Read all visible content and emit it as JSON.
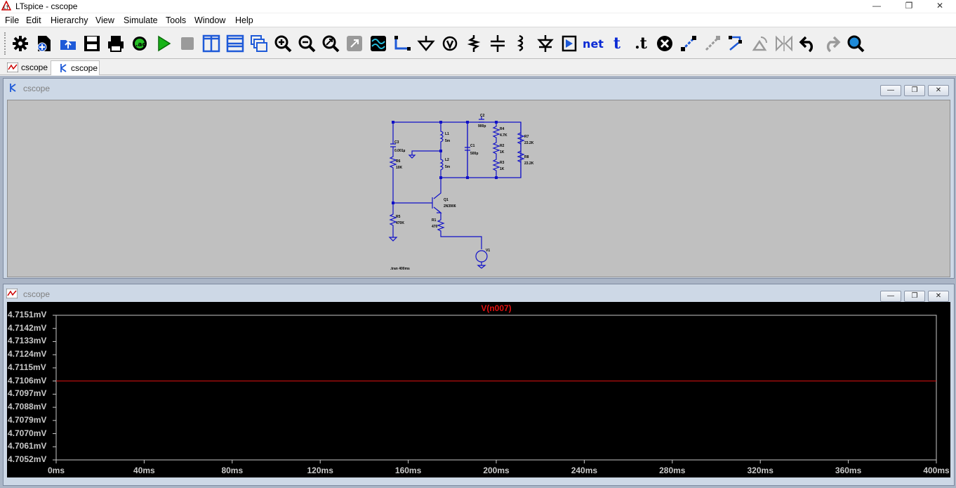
{
  "window": {
    "title": "LTspice - cscope"
  },
  "menu": [
    "File",
    "Edit",
    "Hierarchy",
    "View",
    "Simulate",
    "Tools",
    "Window",
    "Help"
  ],
  "toolbar": {
    "buttons": [
      "settings-icon",
      "new-schematic-icon",
      "open-icon",
      "save-icon",
      "print-icon",
      "spice-directive-icon",
      "run-icon",
      "halt-icon",
      "tile-vertical-icon",
      "tile-horizontal-icon",
      "cascade-icon",
      "zoom-in-icon",
      "zoom-out-icon",
      "zoom-fit-icon",
      "autoscale-icon",
      "waveform-icon",
      "wire-icon",
      "ground-icon",
      "label-net-icon",
      "resistor-icon",
      "capacitor-icon",
      "inductor-icon",
      "diode-icon",
      "component-icon",
      "net-label",
      "text-label",
      "spice-directive-text-label",
      "delete-icon",
      "duplicate-icon",
      "move-icon",
      "drag-icon",
      "rotate-icon",
      "mirror-icon",
      "undo-icon",
      "redo-icon",
      "find-icon"
    ],
    "net_text": "net",
    "t_text": "t",
    "dott_text": ".t"
  },
  "tabs": [
    {
      "label": "cscope",
      "kind": "waveform"
    },
    {
      "label": "cscope",
      "kind": "schematic"
    }
  ],
  "schematic_window": {
    "title": "cscope",
    "labels": {
      "c3": "C3",
      "c3v": "0.001µ",
      "r6": "R6",
      "r6v": "10K",
      "r5": "R5",
      "r5v": "470K",
      "l1": "L1",
      "l1v": "5m",
      "l2": "L2",
      "l2v": "5m",
      "c1": "C1",
      "c1v": "500p",
      "c2": "C2",
      "c2v": "900p",
      "r4": "R4",
      "r4v": "4.7K",
      "r2": "R2",
      "r2v": "1K",
      "r3": "R3",
      "r3v": "1K",
      "r7": "R7",
      "r7v": "23.2K",
      "r8": "R8",
      "r8v": "23.2K",
      "q1": "Q1",
      "q1v": "2N3906",
      "r1": "R1",
      "r1v": "470",
      "v1": "V1",
      "directive": ".tran 400ms"
    }
  },
  "waveform_window": {
    "title": "cscope",
    "button_labels": {
      "minimize": "—",
      "restore": "❐",
      "close": "✕"
    }
  },
  "chart_data": {
    "type": "line",
    "title": "V(n007)",
    "xlabel": "",
    "ylabel": "",
    "x_ticks": [
      "0ms",
      "40ms",
      "80ms",
      "120ms",
      "160ms",
      "200ms",
      "240ms",
      "280ms",
      "320ms",
      "360ms",
      "400ms"
    ],
    "y_ticks": [
      "4.7151mV",
      "4.7142mV",
      "4.7133mV",
      "4.7124mV",
      "4.7115mV",
      "4.7106mV",
      "4.7097mV",
      "4.7088mV",
      "4.7079mV",
      "4.7070mV",
      "4.7061mV",
      "4.7052mV"
    ],
    "xlim": [
      0,
      400
    ],
    "ylim": [
      4.7052,
      4.7151
    ],
    "series": [
      {
        "name": "V(n007)",
        "color": "#e01010",
        "x": [
          0,
          400
        ],
        "y": [
          4.7106,
          4.7106
        ]
      }
    ],
    "grid": false,
    "background": "#000000"
  }
}
